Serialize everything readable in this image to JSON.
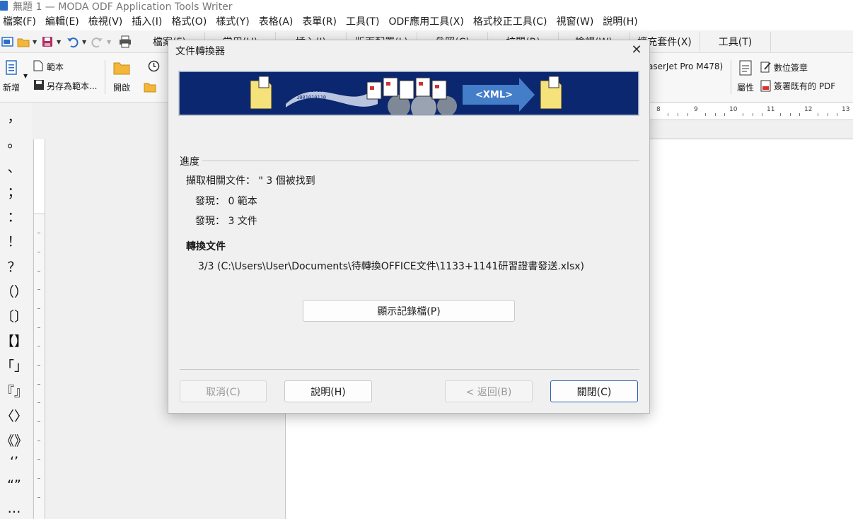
{
  "window": {
    "title": "無題 1 — MODA ODF Application Tools Writer"
  },
  "menu": [
    "檔案(F)",
    "編輯(E)",
    "檢視(V)",
    "插入(I)",
    "格式(O)",
    "樣式(Y)",
    "表格(A)",
    "表單(R)",
    "工具(T)",
    "ODF應用工具(X)",
    "格式校正工具(C)",
    "視窗(W)",
    "說明(H)"
  ],
  "tabs": [
    "檔案(F)",
    "常用(H)",
    "插入(I)",
    "版面配置(L)",
    "參照(C)",
    "校閱(R)",
    "檢視(W)",
    "擴充套件(X)",
    "工具(T)"
  ],
  "ribbon": {
    "new_label": "新增",
    "template_label": "範本",
    "save_as_template_label": "另存為範本...",
    "open_label": "開啟",
    "printer_label": "aserJet Pro M478)",
    "properties_label": "屬性",
    "digital_sign_label": "數位簽章",
    "sign_pdf_label": "簽署既有的 PDF"
  },
  "punctuation": [
    "，",
    "。",
    "、",
    "；",
    "：",
    "！",
    "？",
    "（）",
    "〔〕",
    "【】",
    "「」",
    "『』",
    "〈〉",
    "《》",
    "‘’",
    "“”",
    "…"
  ],
  "ruler_numbers": [
    "8",
    "9",
    "10",
    "11",
    "12",
    "13"
  ],
  "dialog": {
    "title": "文件轉換器",
    "close_glyph": "✕",
    "banner_tag": "<XML>",
    "progress_label": "進度",
    "extract_line": "擷取相關文件：  \" 3  個被找到",
    "found_templates": "發現： 0 範本",
    "found_documents": "發現： 3 文件",
    "convert_label": "轉換文件",
    "convert_path": "3/3  (C:\\Users\\User\\Documents\\待轉換OFFICE文件\\1133+1141研習證書發送.xlsx)",
    "show_log_button": "顯示記錄檔(P)",
    "cancel_button": "取消(C)",
    "help_button": "說明(H)",
    "back_button": "< 返回(B)",
    "close_button": "關閉(C)"
  }
}
